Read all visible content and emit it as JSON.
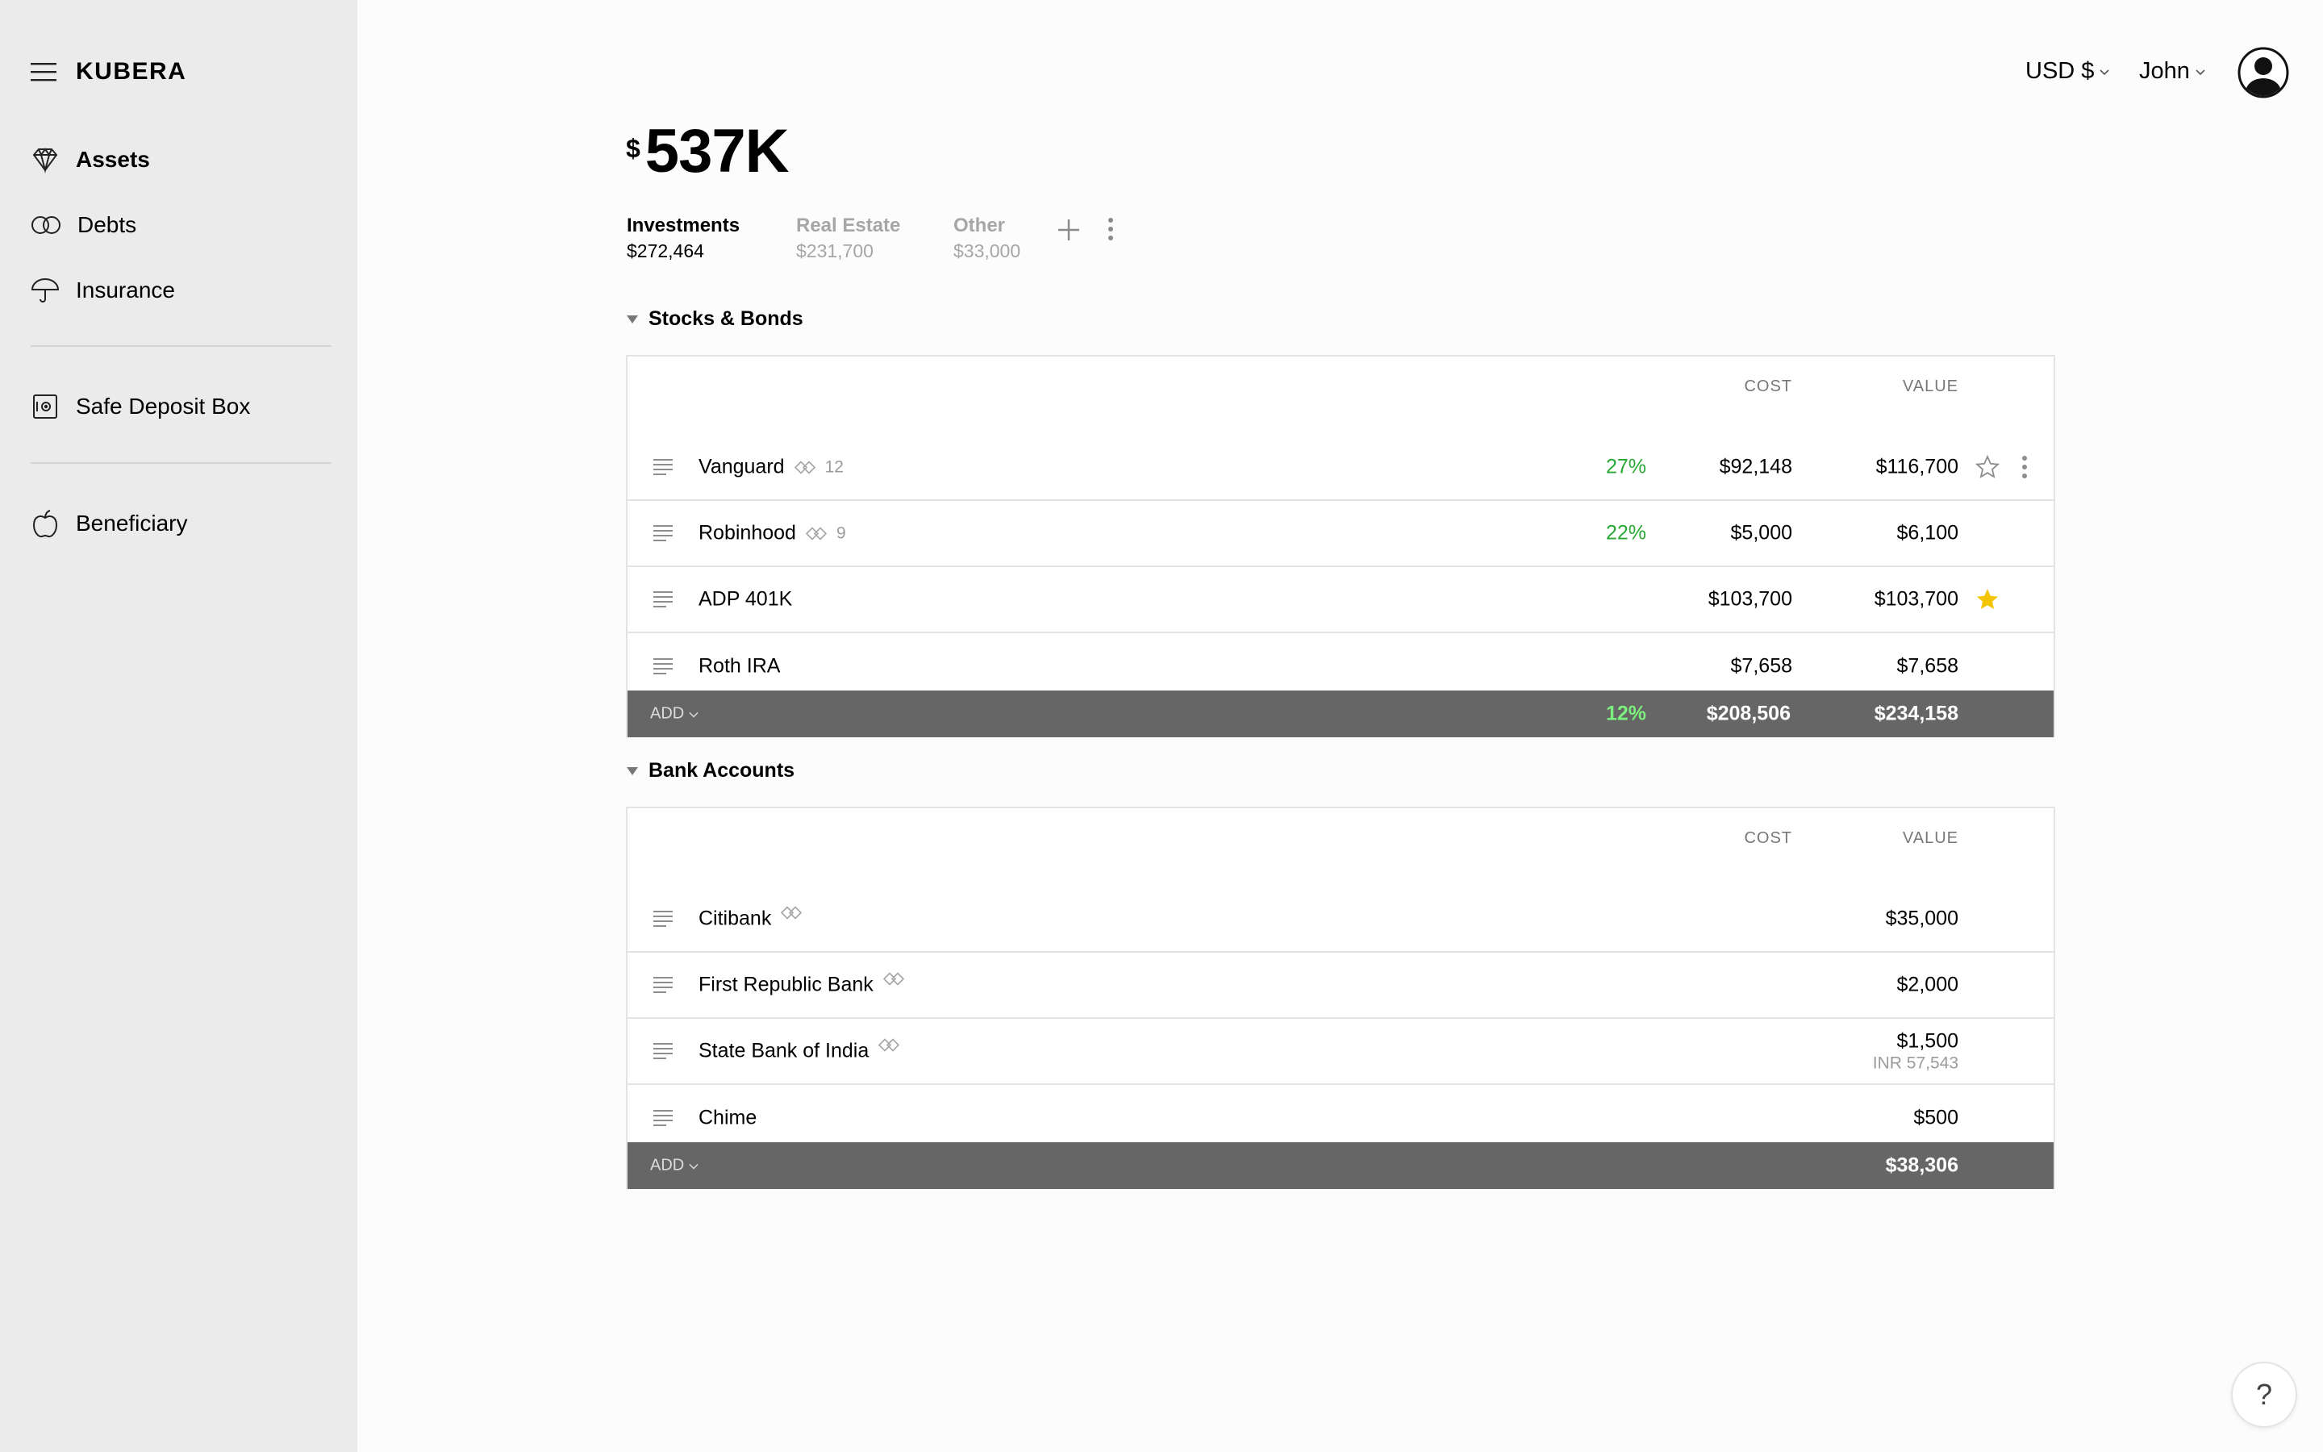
{
  "brand": "KUBERA",
  "sidebar": {
    "items": [
      {
        "label": "Assets",
        "icon": "diamond-icon"
      },
      {
        "label": "Debts",
        "icon": "rings-icon"
      },
      {
        "label": "Insurance",
        "icon": "umbrella-icon"
      },
      {
        "label": "Safe Deposit Box",
        "icon": "safe-icon"
      },
      {
        "label": "Beneficiary",
        "icon": "apple-icon"
      }
    ]
  },
  "header": {
    "currency": "USD $",
    "user": "John"
  },
  "networth": {
    "currency_symbol": "$",
    "amount": "537K"
  },
  "tabs": [
    {
      "label": "Investments",
      "value": "$272,464"
    },
    {
      "label": "Real Estate",
      "value": "$231,700"
    },
    {
      "label": "Other",
      "value": "$33,000"
    }
  ],
  "columns": {
    "cost": "COST",
    "value": "VALUE"
  },
  "stocks": {
    "title": "Stocks & Bonds",
    "rows": [
      {
        "name": "Vanguard",
        "linked_count": "12",
        "pct": "27%",
        "cost": "$92,148",
        "value": "$116,700"
      },
      {
        "name": "Robinhood",
        "linked_count": "9",
        "pct": "22%",
        "cost": "$5,000",
        "value": "$6,100"
      },
      {
        "name": "ADP 401K",
        "cost": "$103,700",
        "value": "$103,700"
      },
      {
        "name": "Roth IRA",
        "cost": "$7,658",
        "value": "$7,658"
      }
    ],
    "footer": {
      "add": "ADD",
      "pct": "12%",
      "cost": "$208,506",
      "value": "$234,158"
    }
  },
  "bank": {
    "title": "Bank Accounts",
    "rows": [
      {
        "name": "Citibank",
        "value": "$35,000"
      },
      {
        "name": "First Republic Bank",
        "value": "$2,000"
      },
      {
        "name": "State Bank of India",
        "value": "$1,500",
        "sub_value": "INR 57,543"
      },
      {
        "name": "Chime",
        "value": "$500"
      }
    ],
    "footer": {
      "add": "ADD",
      "value": "$38,306"
    }
  },
  "help": "?",
  "colors": {
    "sidebar": "#ebebeb",
    "footer": "#666666",
    "green": "#2aa834",
    "star": "#f5c400"
  }
}
